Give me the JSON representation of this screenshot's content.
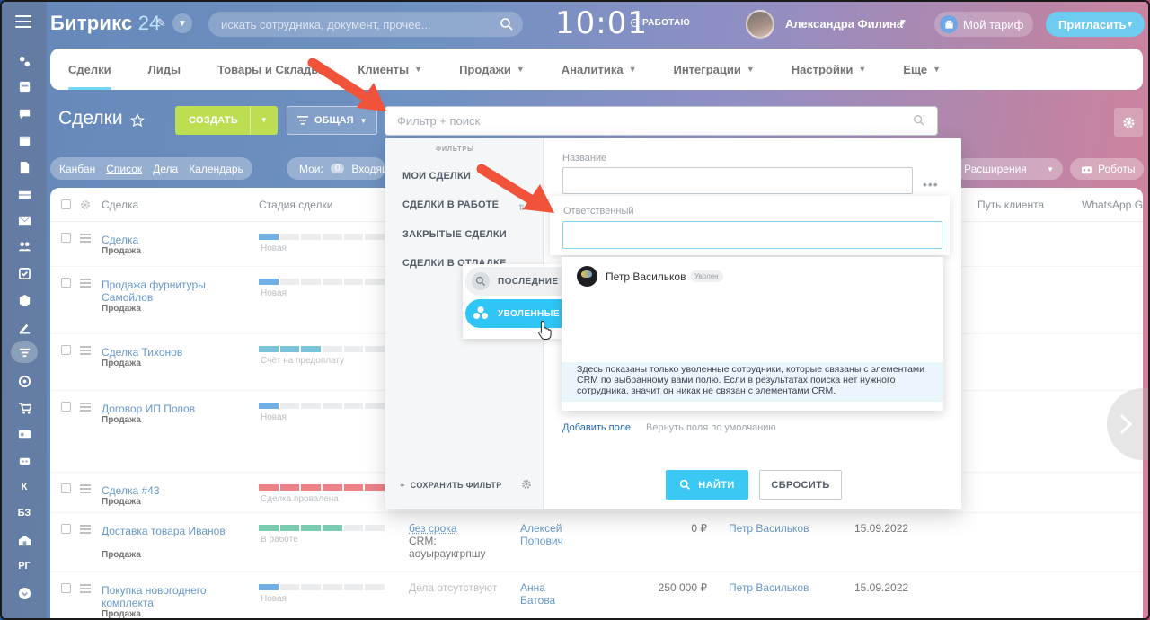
{
  "header": {
    "brand": "Битрикс",
    "brand_num": "24",
    "search_placeholder": "искать сотрудника, документ, прочее...",
    "clock": "10:01",
    "work_status": "РАБОТАЮ",
    "user_name": "Александра Филина",
    "tariff": "Мой тариф",
    "invite": "Пригласить"
  },
  "sidebar": {
    "letters": [
      "К",
      "БЗ",
      "РГ"
    ]
  },
  "menu": [
    {
      "label": "Сделки",
      "chev": false,
      "active": true
    },
    {
      "label": "Лиды",
      "chev": false
    },
    {
      "label": "Товары и Склады",
      "chev": false
    },
    {
      "label": "Клиенты",
      "chev": true
    },
    {
      "label": "Продажи",
      "chev": true
    },
    {
      "label": "Аналитика",
      "chev": true
    },
    {
      "label": "Интеграции",
      "chev": true
    },
    {
      "label": "Настройки",
      "chev": true
    },
    {
      "label": "Еще",
      "chev": true
    }
  ],
  "page": {
    "title": "Сделки",
    "create": "СОЗДАТЬ",
    "preset": "ОБЩАЯ",
    "filter_placeholder": "Фильтр + поиск",
    "views": [
      "Канбан",
      "Список",
      "Дела",
      "Календарь"
    ],
    "mine_label": "Мои:",
    "mine_count": "0",
    "mine_text": "Входящ",
    "extensions": "Расширения",
    "robots": "Роботы"
  },
  "table": {
    "headers": {
      "deal": "Сделка",
      "stage": "Стадия сделки",
      "path": "Путь клиента",
      "whatsapp": "WhatsApp G"
    },
    "rows": [
      {
        "title": "Сделка",
        "sub": "Продажа",
        "stage": "Новая",
        "progress": 1,
        "color": "#2f8ad8"
      },
      {
        "title": "Продажа фурнитуры Самойлов",
        "sub": "Продажа",
        "stage": "Новая",
        "progress": 1,
        "color": "#2f8ad8"
      },
      {
        "title": "Сделка Тихонов",
        "sub": "Продажа",
        "stage": "Счёт на предоплату",
        "progress": 3,
        "color": "#39a8c9"
      },
      {
        "title": "Договор ИП Попов",
        "sub": "Продажа",
        "stage": "Новая",
        "progress": 1,
        "color": "#2f8ad8"
      },
      {
        "title": "Сделка #43",
        "sub": "Продажа",
        "stage": "Сделка провалена",
        "progress": 6,
        "color": "#e2474e"
      },
      {
        "title": "Доставка товара Иванов",
        "sub": "Продажа",
        "stage": "В работе",
        "progress": 4,
        "color": "#3bb48b",
        "activity": "без срока",
        "activity2": "CRM:",
        "activity3": "аоуыраукгрпшу",
        "resp": "Алексей Попович",
        "sum": "0 ₽",
        "client": "Петр Васильков",
        "date": "15.09.2022"
      },
      {
        "title": "Покупка новогоднего комплекта",
        "sub": "Продажа",
        "stage": "Новая",
        "progress": 1,
        "color": "#2f8ad8",
        "activity": "Дела отсутствуют",
        "resp": "Анна Батова",
        "sum": "250 000 ₽",
        "client": "Петр Васильков",
        "date": "15.09.2022"
      }
    ]
  },
  "filter": {
    "caption": "ФИЛЬТРЫ",
    "presets": [
      "МОИ СДЕЛКИ",
      "СДЕЛКИ В РАБОТЕ",
      "ЗАКРЫТЫЕ СДЕЛКИ",
      "СДЕЛКИ В ОТЛАДКЕ"
    ],
    "save": "СОХРАНИТЬ ФИЛЬТР",
    "field_name": "Название",
    "field_responsible": "Ответственный",
    "add_field": "Добавить поле",
    "reset_fields": "Вернуть поля по умолчанию",
    "find": "НАЙТИ",
    "reset": "СБРОСИТЬ",
    "tab_recent": "ПОСЛЕДНИЕ",
    "tab_fired": "УВОЛЕННЫЕ",
    "result_name": "Петр Васильков",
    "result_badge": "Уволен",
    "note": "Здесь показаны только уволенные сотрудники, которые связаны с элементами CRM по выбранному вами полю. Если в результатах поиска нет нужного сотрудника, значит он никак не связан с элементами CRM."
  },
  "colors": {
    "accent": "#2fc6f6",
    "create": "#9dcf00",
    "arrow": "#f0533a",
    "link": "#2067b0"
  }
}
